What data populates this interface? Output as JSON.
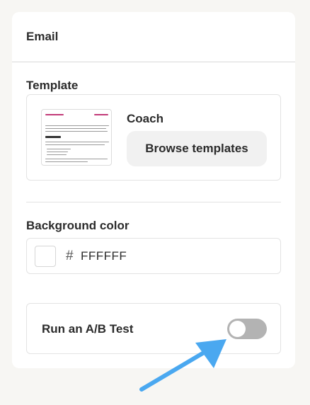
{
  "panel": {
    "title": "Email"
  },
  "template": {
    "label": "Template",
    "name": "Coach",
    "browse_label": "Browse templates",
    "thumbnail_icon": "email-template-thumbnail"
  },
  "background": {
    "label": "Background color",
    "hash": "#",
    "value": "FFFFFF",
    "swatch_color": "#FFFFFF"
  },
  "ab_test": {
    "label": "Run an A/B Test",
    "enabled": false
  },
  "colors": {
    "page_bg": "#f7f6f3",
    "panel_bg": "#ffffff",
    "toggle_off": "#b3b3b3",
    "annotation_arrow": "#4aa8f0"
  }
}
